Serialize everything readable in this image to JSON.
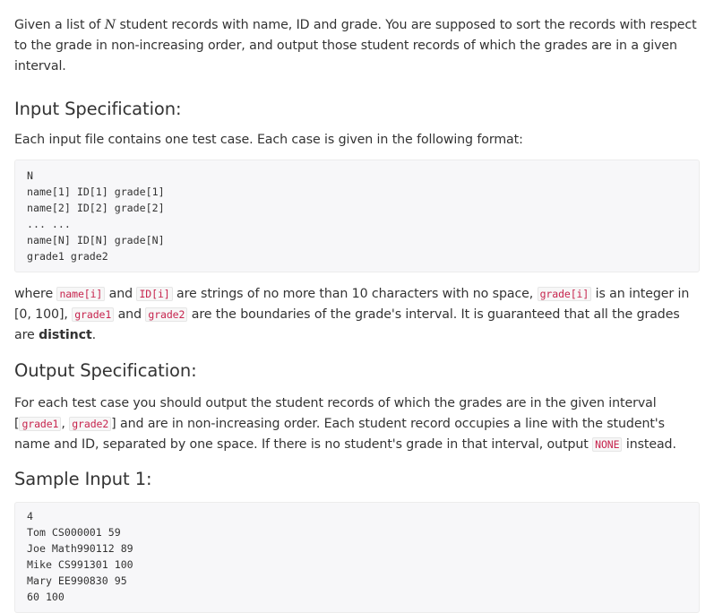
{
  "intro": {
    "t1": "Given a list of ",
    "math_n": "N",
    "t2": " student records with name, ID and grade. You are supposed to sort the records with respect to the grade in non-increasing order, and output those student records of which the grades are in a given interval."
  },
  "input_section": {
    "heading": "Input Specification:",
    "description": "Each input file contains one test case. Each case is given in the following format:",
    "format_block": "N\nname[1] ID[1] grade[1]\nname[2] ID[2] grade[2]\n... ...\nname[N] ID[N] grade[N]\ngrade1 grade2",
    "where": {
      "t1": "where ",
      "c1": "name[i]",
      "t2": " and ",
      "c2": "ID[i]",
      "t3": " are strings of no more than 10 characters with no space, ",
      "c3": "grade[i]",
      "t4": " is an integer in [0, 100], ",
      "c4": "grade1",
      "t5": " and ",
      "c5": "grade2",
      "t6": " are the boundaries of the grade's interval. It is guaranteed that all the grades are ",
      "bold": "dis­tinct",
      "t7": "."
    }
  },
  "output_section": {
    "heading": "Output Specification:",
    "t1": "For each test case you should output the student records of which the grades are in the given interval [",
    "c1": "grade1",
    "t2": ", ",
    "c2": "grade2",
    "t3": "] and are in non-increasing order. Each student record occupies a line with the student's name and ID, separated by one space. If there is no student's grade in that interval, output ",
    "c3": "NONE",
    "t4": " instead."
  },
  "sample_section": {
    "heading": "Sample Input 1:",
    "block": "4\nTom CS000001 59\nJoe Math990112 89\nMike CS991301 100\nMary EE990830 95\n60 100"
  }
}
